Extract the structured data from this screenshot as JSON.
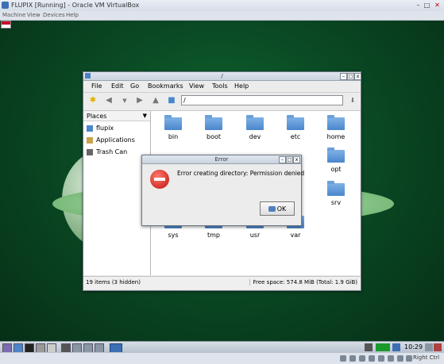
{
  "vbox": {
    "title": "FLUPIX [Running] - Oracle VM VirtualBox",
    "menu": [
      "Machine",
      "View",
      "Devices",
      "Help"
    ],
    "host_key": "Right Ctrl",
    "icons": [
      "flupix-vm-icon"
    ]
  },
  "file_manager": {
    "title": "/",
    "menu": [
      "File",
      "Edit",
      "Go",
      "Bookmarks",
      "View",
      "Tools",
      "Help"
    ],
    "path": "/",
    "places_label": "Places",
    "places": [
      {
        "label": "flupix",
        "icon": "home-folder-icon"
      },
      {
        "label": "Applications",
        "icon": "applications-icon"
      },
      {
        "label": "Trash Can",
        "icon": "trash-icon"
      }
    ],
    "files": [
      "bin",
      "boot",
      "dev",
      "etc",
      "home",
      "opt",
      "srv",
      "sys",
      "tmp",
      "usr",
      "var"
    ],
    "status_left": "19 items (3 hidden)",
    "status_right": "Free space: 574.8 MiB (Total: 1.9 GiB)"
  },
  "dialog": {
    "title": "Error",
    "message": "Error creating directory: Permission denied",
    "ok_label": "OK"
  },
  "taskbar": {
    "clock": "10:29"
  },
  "colors": {
    "desktop_green": "#0a4a24",
    "folder_blue": "#4a86cc",
    "error_red": "#c01010"
  }
}
